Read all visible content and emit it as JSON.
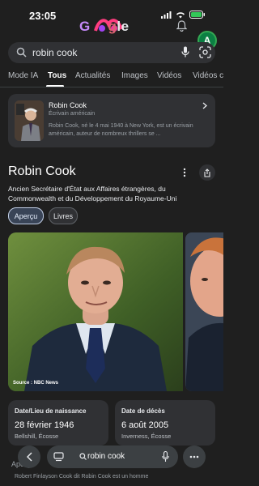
{
  "status": {
    "time": "23:05"
  },
  "header": {
    "doodle_text": "Google",
    "avatar_letter": "A"
  },
  "search": {
    "query": "robin cook"
  },
  "tabs": [
    {
      "label": "Mode IA"
    },
    {
      "label": "Tous"
    },
    {
      "label": "Actualités"
    },
    {
      "label": "Images"
    },
    {
      "label": "Vidéos"
    },
    {
      "label": "Vidéos co"
    }
  ],
  "card": {
    "title": "Robin Cook",
    "subtitle": "Écrivain américain",
    "description": "Robin Cook, né le 4 mai 1940 à New York, est un écrivain américain, auteur de nombreux thrillers se ..."
  },
  "entity": {
    "title": "Robin Cook",
    "description": "Ancien Secrétaire d'État aux Affaires étrangères, du Commonwealth et du Développement du Royaume-Uni",
    "chips": [
      "Aperçu",
      "Livres"
    ],
    "photo_source": "Source : NBC News"
  },
  "facts": [
    {
      "label": "Date/Lieu de naissance",
      "value": "28 février 1946",
      "place": "Bellshill, Écosse"
    },
    {
      "label": "Date de décès",
      "value": "6 août 2005",
      "place": "Inverness, Écosse"
    }
  ],
  "section": {
    "label": "Aperçu",
    "text": "Robert Finlayson Cook dit Robin Cook est un homme"
  },
  "bottom_bar": {
    "query": "robin cook"
  },
  "colors": {
    "background": "#1f1f1f",
    "surface": "#303134",
    "chip_active": "#394457",
    "avatar": "#0b8043"
  }
}
